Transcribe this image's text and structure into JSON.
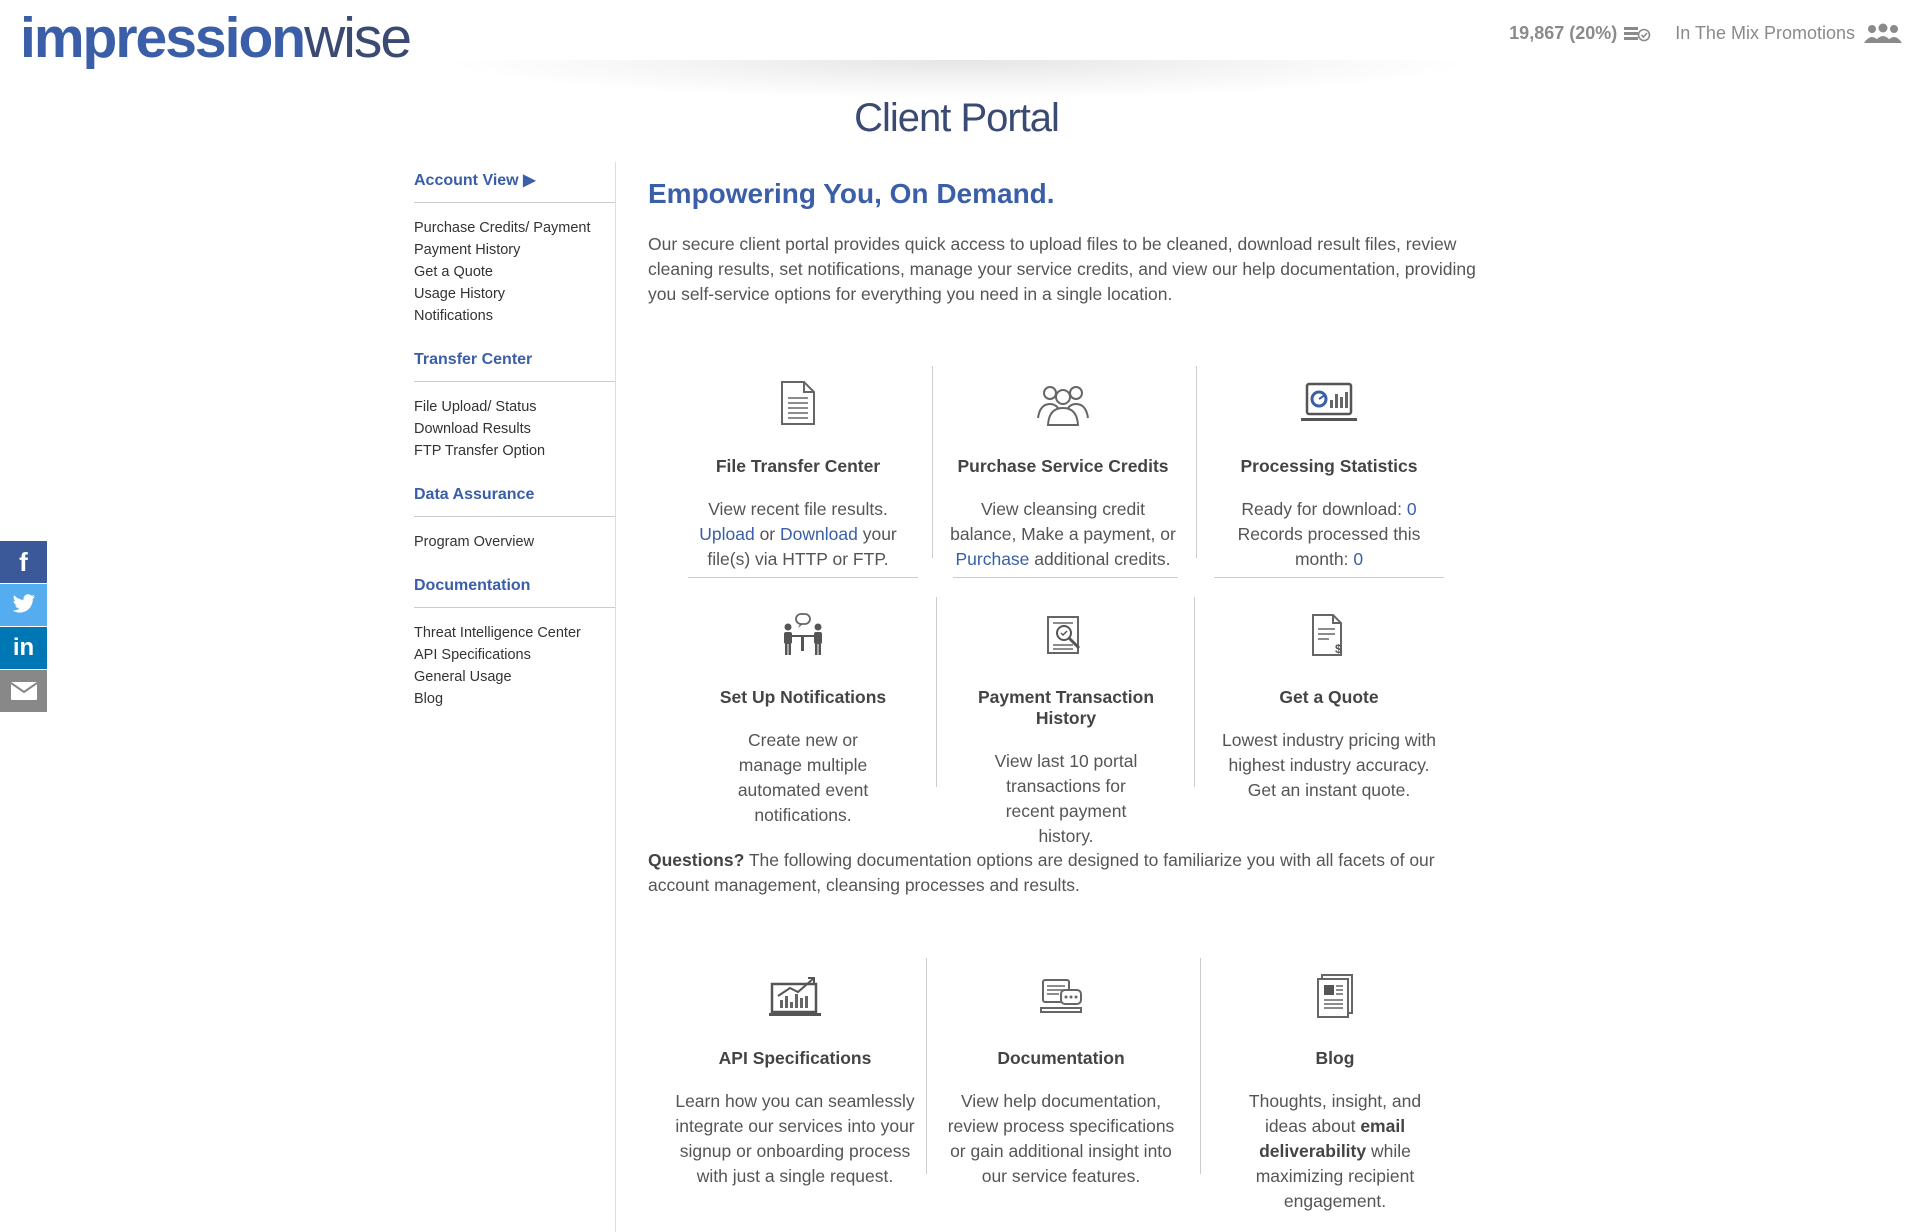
{
  "header": {
    "logo_part1": "impression",
    "logo_part2": "wise",
    "credits": "19,867 (20%)",
    "account_name": "In The Mix Promotions",
    "icons": [
      "credits-stack-icon",
      "users-icon"
    ]
  },
  "page_title": "Client Portal",
  "social": [
    {
      "name": "facebook",
      "glyph": "f",
      "color": "#3b5998"
    },
    {
      "name": "twitter",
      "glyph": "t",
      "color": "#55acee"
    },
    {
      "name": "linkedin",
      "glyph": "in",
      "color": "#0077b5"
    },
    {
      "name": "email",
      "glyph": "✉",
      "color": "#888888"
    }
  ],
  "sidebar": {
    "sections": [
      {
        "title": "Account View ▶",
        "items": [
          "Purchase Credits/ Payment",
          "Payment History",
          "Get a Quote",
          "Usage History",
          "Notifications"
        ]
      },
      {
        "title": "Transfer Center",
        "items": [
          "File Upload/ Status",
          "Download Results",
          "FTP Transfer Option"
        ]
      },
      {
        "title": "Data Assurance",
        "items": [
          "Program Overview"
        ]
      },
      {
        "title": "Documentation",
        "items": [
          "Threat Intelligence Center",
          "API Specifications",
          "General Usage",
          "Blog"
        ]
      }
    ]
  },
  "main": {
    "headline": "Empowering You, On Demand.",
    "intro": "Our secure client portal provides quick access to upload files to be cleaned, download result files, review cleaning results, set notifications, manage your service credits, and view our help documentation, providing you self-service options for everything you need in a single location.",
    "cards": {
      "file_transfer": {
        "title": "File Transfer Center",
        "line1": "View recent file results.",
        "upload": "Upload",
        "or": "or",
        "download": "Download",
        "rest": "your file(s) via HTTP or FTP."
      },
      "purchase": {
        "title": "Purchase Service Credits",
        "text": "View cleansing credit balance, Make a payment, or",
        "link": "Purchase",
        "rest": "additional credits."
      },
      "stats": {
        "title": "Processing Statistics",
        "ready_label": "Ready for download:",
        "ready_value": "0",
        "records_label": "Records processed this month:",
        "records_value": "0"
      },
      "notifications": {
        "title": "Set Up Notifications",
        "text": "Create new or manage multiple automated event notifications."
      },
      "payment_history": {
        "title": "Payment Transaction History",
        "text": "View last 10 portal transactions for recent payment history."
      },
      "quote": {
        "title": "Get a Quote",
        "text": "Lowest industry pricing with highest industry accuracy. Get an instant quote."
      }
    },
    "questions_bold": "Questions?",
    "questions_text": "The following documentation options are designed to familiarize you with all facets of our account management, cleansing processes and results.",
    "doc_cards": {
      "api": {
        "title": "API Specifications",
        "text": "Learn how you can seamlessly integrate our services into your signup or onboarding process with just a single request."
      },
      "docs": {
        "title": "Documentation",
        "text": "View help documentation, review process specifications or gain additional insight into our service features."
      },
      "blog": {
        "title": "Blog",
        "pre": "Thoughts, insight, and ideas about",
        "bold": "email deliverability",
        "post": "while maximizing recipient engagement."
      }
    }
  }
}
